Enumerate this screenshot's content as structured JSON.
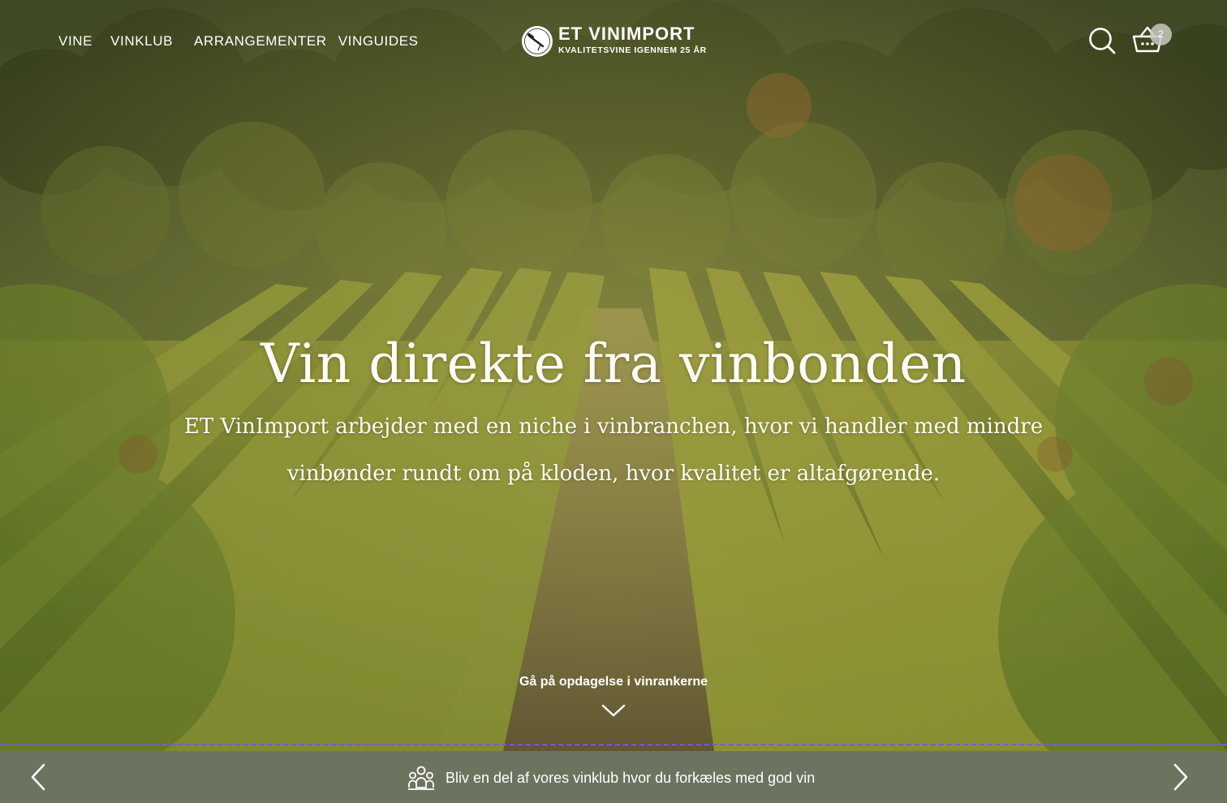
{
  "header": {
    "nav": [
      {
        "label": "VINE"
      },
      {
        "label": "VINKLUB"
      },
      {
        "label": "ARRANGEMENTER"
      },
      {
        "label": "VINGUIDES"
      }
    ],
    "logo": {
      "brand": "ET VinImport",
      "tagline": "Kvalitetsvine igennem 25 år"
    },
    "icons": {
      "search": "search-icon",
      "cart": "basket-icon"
    },
    "cart_count": "2"
  },
  "hero": {
    "title": "Vin direkte fra vinbonden",
    "subtitle": "ET VinImport arbejder med en niche i vinbranchen, hvor vi handler med mindre vinbønder rundt om på kloden, hvor kvalitet er altafgørende.",
    "scroll_label": "Gå på opdagelse i vinrankerne"
  },
  "announcement": {
    "text": "Bliv en del af vores vinklub hvor du forkæles med god vin",
    "icon": "people-icon",
    "background": "#6c745f"
  },
  "colors": {
    "text_light": "#ffffff",
    "bar": "#6c745f",
    "divider": "#7a5bd0"
  }
}
